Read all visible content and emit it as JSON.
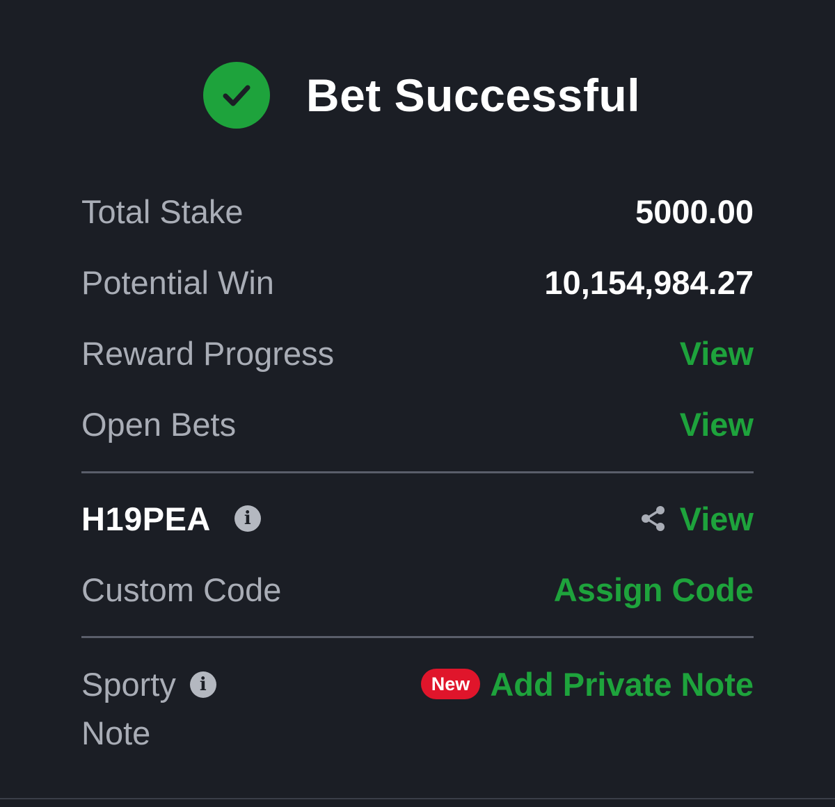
{
  "theme": {
    "accent": "#1ea33c",
    "success": "#1ea33c",
    "badge": "#e0152b"
  },
  "header": {
    "icon": "check-circle-icon",
    "title": "Bet Successful"
  },
  "summary": {
    "total_stake_label": "Total Stake",
    "total_stake_value": "5000.00",
    "potential_win_label": "Potential Win",
    "potential_win_value": "10,154,984.27",
    "reward_progress_label": "Reward Progress",
    "reward_progress_link": "View",
    "open_bets_label": "Open Bets",
    "open_bets_link": "View"
  },
  "booking": {
    "code": "H19PEA",
    "info_icon": "info-icon",
    "share_icon": "share-icon",
    "view_link": "View",
    "custom_code_label": "Custom Code",
    "assign_code_link": "Assign Code"
  },
  "note": {
    "label_line1": "Sporty",
    "label_line2": "Note",
    "info_icon": "info-icon",
    "badge": "New",
    "add_note_link": "Add Private Note"
  }
}
